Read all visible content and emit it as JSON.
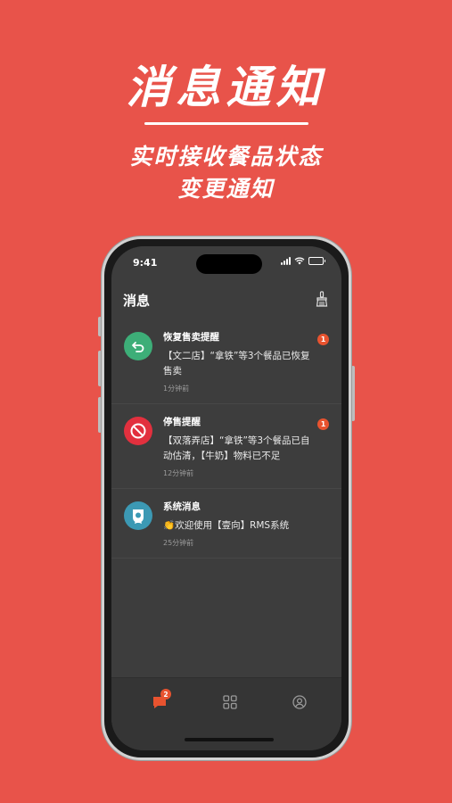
{
  "promo": {
    "headline": "消息通知",
    "subtitle_line1": "实时接收餐品状态",
    "subtitle_line2": "变更通知"
  },
  "status_bar": {
    "time": "9:41"
  },
  "header": {
    "title": "消息",
    "clean_icon": "broom-icon"
  },
  "messages": [
    {
      "icon": "restore-arrow-icon",
      "icon_color": "#3DAE78",
      "title": "恢复售卖提醒",
      "body": "【文二店】“拿铁”等3个餐品已恢复售卖",
      "time": "1分钟前",
      "badge": "1"
    },
    {
      "icon": "no-entry-icon",
      "icon_color": "#E2303E",
      "title": "停售提醒",
      "body": "【双落弄店】“拿铁”等3个餐品已自动估清，【牛奶】物料已不足",
      "time": "12分钟前",
      "badge": "1"
    },
    {
      "icon": "system-medal-icon",
      "icon_color": "#3C99B4",
      "title": "系统消息",
      "body": "👏欢迎使用【壹向】RMS系统",
      "time": "25分钟前",
      "badge": ""
    }
  ],
  "tab_bar": {
    "messages_badge": "2",
    "tabs": [
      "message-icon",
      "apps-grid-icon",
      "profile-icon"
    ],
    "active_color": "#E8532F",
    "inactive_color": "#9a9a9a"
  },
  "colors": {
    "background": "#E8534A",
    "screen": "#3D3D3D",
    "badge": "#E8532F"
  }
}
